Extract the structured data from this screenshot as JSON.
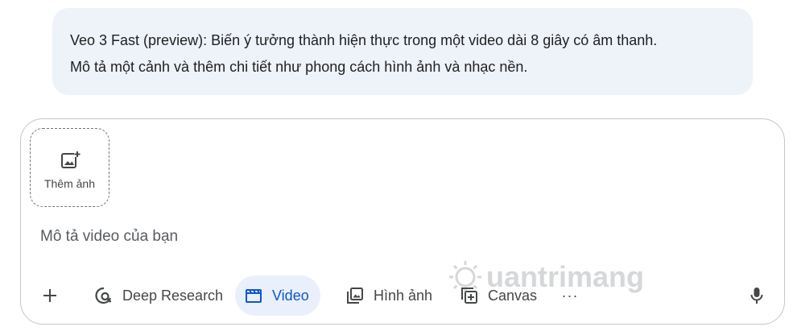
{
  "info": {
    "line1": "Veo 3 Fast (preview): Biến ý tưởng thành hiện thực trong một video dài 8 giây có âm thanh.",
    "line2": "Mô tả một cảnh và thêm chi tiết như phong cách hình ảnh và nhạc nền."
  },
  "composer": {
    "add_photo_label": "Thêm ảnh",
    "add_photo_icon": "add-photo-icon",
    "input_placeholder": "Mô tả video của bạn",
    "input_value": ""
  },
  "toolbar": {
    "plus_icon": "plus-icon",
    "deep_research_label": "Deep Research",
    "deep_research_icon": "deep-research-icon",
    "video_label": "Video",
    "video_icon": "clapperboard-icon",
    "image_label": "Hình ảnh",
    "image_icon": "image-stack-icon",
    "canvas_label": "Canvas",
    "canvas_icon": "canvas-icon",
    "more_label": "···",
    "mic_icon": "microphone-icon"
  },
  "colors": {
    "bubble_bg": "#eef2f9",
    "accent": "#0b57d0",
    "video_chip_bg": "#eaf0fb",
    "border": "#c4c7c5"
  },
  "watermark": {
    "text": "uantrimang"
  }
}
